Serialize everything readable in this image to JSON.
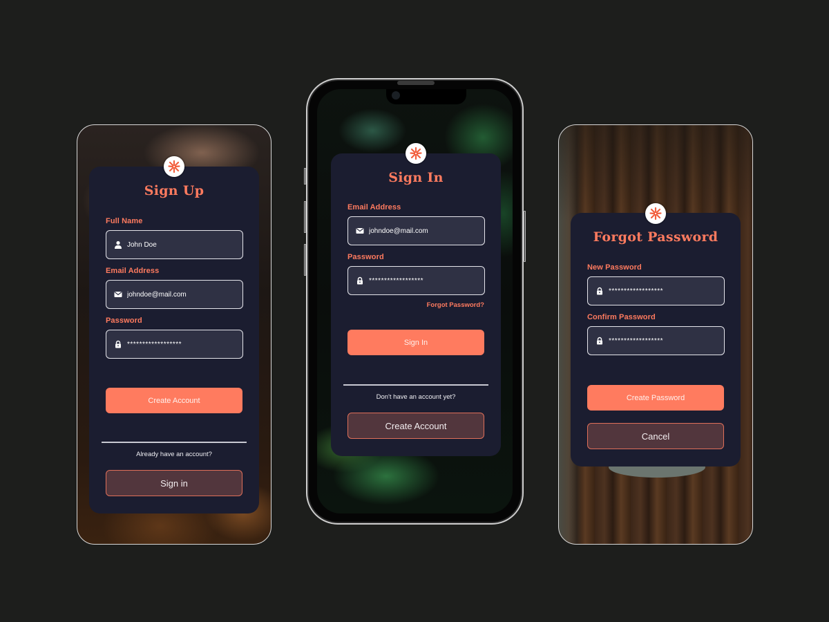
{
  "colors": {
    "accent": "#ff7b5f",
    "card_bg": "#1b1d30",
    "field_bg": "#2f3144",
    "secondary_btn_bg": "#52363d",
    "page_bg": "#1d1e1c"
  },
  "sign_up": {
    "logo_icon": "asterisk-burst-icon",
    "title": "Sign Up",
    "fields": [
      {
        "label": "Full Name",
        "icon": "user-icon",
        "value": "John Doe",
        "type": "text"
      },
      {
        "label": "Email Address",
        "icon": "mail-icon",
        "value": "johndoe@mail.com",
        "type": "email"
      },
      {
        "label": "Password",
        "icon": "lock-icon",
        "value": "******************",
        "type": "password"
      }
    ],
    "primary_button": "Create Account",
    "prompt": "Already have an account?",
    "secondary_button": "Sign in"
  },
  "sign_in": {
    "logo_icon": "asterisk-burst-icon",
    "title": "Sign In",
    "fields": [
      {
        "label": "Email Address",
        "icon": "mail-icon",
        "value": "johndoe@mail.com",
        "type": "email"
      },
      {
        "label": "Password",
        "icon": "lock-icon",
        "value": "******************",
        "type": "password"
      }
    ],
    "forgot_link": "Forgot Password?",
    "primary_button": "Sign In",
    "prompt": "Don't have an account yet?",
    "secondary_button": "Create Account"
  },
  "forgot_password": {
    "logo_icon": "asterisk-burst-icon",
    "title": "Forgot Password",
    "fields": [
      {
        "label": "New Password",
        "icon": "lock-icon",
        "value": "******************",
        "type": "password"
      },
      {
        "label": "Confirm Password",
        "icon": "lock-icon",
        "value": "******************",
        "type": "password"
      }
    ],
    "primary_button": "Create Password",
    "secondary_button": "Cancel"
  }
}
